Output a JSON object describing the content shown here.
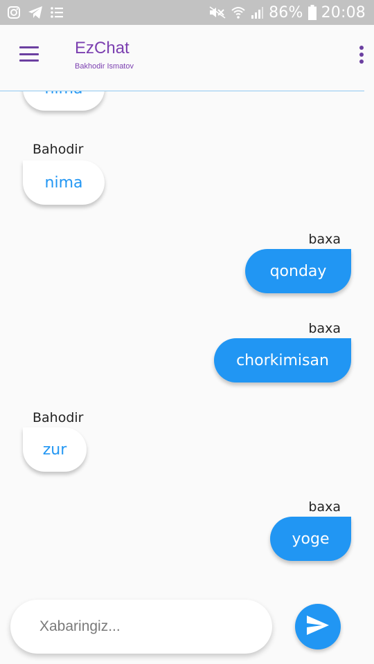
{
  "status_bar": {
    "icons_left": [
      "instagram-icon",
      "telegram-icon",
      "list-icon"
    ],
    "icons_right": [
      "mute-icon",
      "wifi-icon",
      "signal-icon",
      "battery-icon"
    ],
    "battery": "86%",
    "time": "20:08"
  },
  "app_bar": {
    "title": "EzChat",
    "subtitle": "Bakhodir Ismatov",
    "menu_icon": "hamburger-menu-icon",
    "more_icon": "more-vert-icon"
  },
  "chat": {
    "messages": [
      {
        "direction": "in",
        "sender": "",
        "text": "nima"
      },
      {
        "direction": "in",
        "sender": "Bahodir",
        "text": "nima"
      },
      {
        "direction": "out",
        "sender": "baxa",
        "text": "qonday"
      },
      {
        "direction": "out",
        "sender": "baxa",
        "text": "chorkimisan"
      },
      {
        "direction": "in",
        "sender": "Bahodir",
        "text": "zur"
      },
      {
        "direction": "out",
        "sender": "baxa",
        "text": "yoge"
      }
    ]
  },
  "composer": {
    "placeholder": "Xabaringiz...",
    "value": "",
    "send_icon": "send-icon"
  },
  "colors": {
    "accent_purple": "#7b3fb0",
    "bubble_blue": "#2196f3",
    "status_bar": "#c2c2c2",
    "background": "#fafafa"
  }
}
